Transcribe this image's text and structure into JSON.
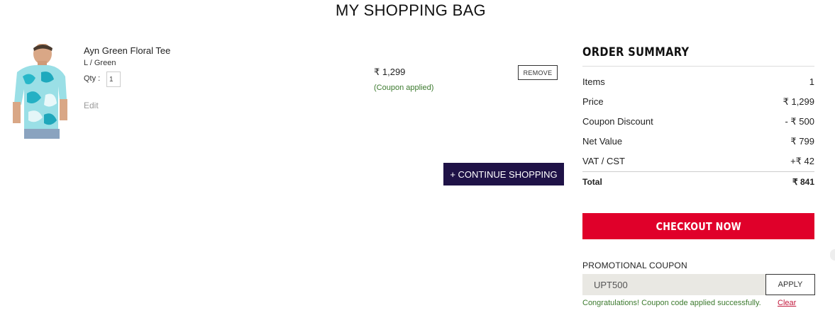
{
  "page": {
    "title": "MY SHOPPING BAG"
  },
  "cart": {
    "item": {
      "name": "Ayn Green Floral Tee",
      "variant": "L / Green",
      "qty_label": "Qty :",
      "qty_value": "1",
      "edit_label": "Edit",
      "price": "₹ 1,299",
      "coupon_note": "(Coupon applied)",
      "remove_label": "REMOVE",
      "image_icon": "product-photo"
    },
    "continue_label": "+ CONTINUE SHOPPING"
  },
  "summary": {
    "title": "ORDER SUMMARY",
    "rows": [
      {
        "label": "Items",
        "value": "1"
      },
      {
        "label": "Price",
        "value": "₹ 1,299"
      },
      {
        "label": "Coupon Discount",
        "value": "- ₹ 500"
      },
      {
        "label": "Net Value",
        "value": "₹ 799"
      },
      {
        "label": "VAT / CST",
        "value": "+₹ 42"
      }
    ],
    "total": {
      "label": "Total",
      "value": "₹ 841"
    },
    "checkout_label": "CHECKOUT NOW"
  },
  "promo": {
    "label": "PROMOTIONAL COUPON",
    "code": "UPT500",
    "apply_label": "APPLY",
    "success_message": "Congratulations! Coupon code applied successfully.",
    "clear_label": "Clear"
  },
  "colors": {
    "checkout": "#e0002a",
    "continue": "#1f1247",
    "success": "#3c7a2e",
    "clear": "#c2183c"
  }
}
